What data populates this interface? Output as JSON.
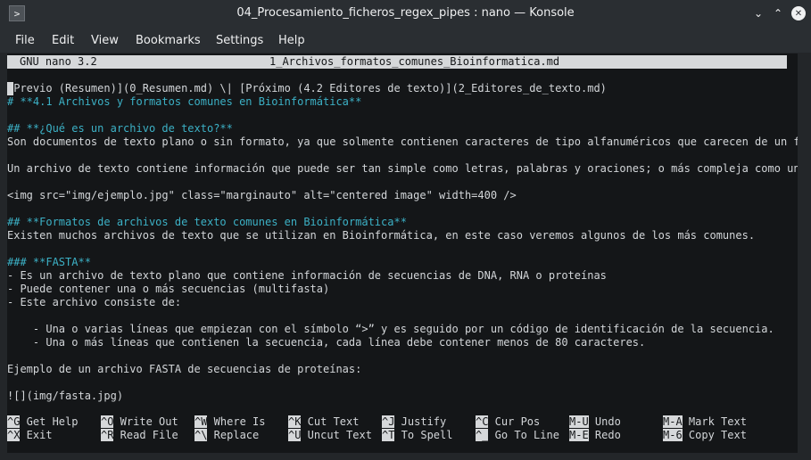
{
  "window": {
    "title": "04_Procesamiento_ficheros_regex_pipes : nano — Konsole",
    "app_icon": ">"
  },
  "menu": [
    "File",
    "Edit",
    "View",
    "Bookmarks",
    "Settings",
    "Help"
  ],
  "nano": {
    "version": "GNU nano 3.2",
    "filename": "1_Archivos_formatos_comunes_Bioinformatica.md",
    "lines": [
      {
        "text": "[Previo (Resumen)](0_Resumen.md) \\| [Próximo (4.2 Editores de texto)](2_Editores_de_texto.md)",
        "style": "normal"
      },
      {
        "text": "# **4.1 Archivos y formatos comunes en Bioinformática**",
        "style": "cyan"
      },
      {
        "text": "",
        "style": "normal"
      },
      {
        "text": "## **¿Qué es un archivo de texto?**",
        "style": "cyan"
      },
      {
        "text": "Son documentos de texto plano o sin formato, ya que solmente contienen caracteres de tipo alfanuméricos que carecen de un fo$",
        "style": "normal"
      },
      {
        "text": "",
        "style": "normal"
      },
      {
        "text": "Un archivo de texto contiene información que puede ser tan simple como letras, palabras y oraciones; o más compleja como un $",
        "style": "normal"
      },
      {
        "text": "",
        "style": "normal"
      },
      {
        "text": "<img src=\"img/ejemplo.jpg\" class=\"marginauto\" alt=\"centered image\" width=400 />",
        "style": "normal"
      },
      {
        "text": "",
        "style": "normal"
      },
      {
        "text": "## **Formatos de archivos de texto comunes en Bioinformática**",
        "style": "cyan"
      },
      {
        "text": "Existen muchos archivos de texto que se utilizan en Bioinformática, en este caso veremos algunos de los más comunes.",
        "style": "normal"
      },
      {
        "text": "",
        "style": "normal"
      },
      {
        "text": "### **FASTA**",
        "style": "cyan"
      },
      {
        "text": "- Es un archivo de texto plano que contiene información de secuencias de DNA, RNA o proteínas",
        "style": "normal"
      },
      {
        "text": "- Puede contener una o más secuencias (multifasta)",
        "style": "normal"
      },
      {
        "text": "- Este archivo consiste de:",
        "style": "normal"
      },
      {
        "text": "",
        "style": "normal"
      },
      {
        "text": "    - Una o varias líneas que empiezan con el símbolo “>” y es seguido por un código de identificación de la secuencia.",
        "style": "normal"
      },
      {
        "text": "    - Una o más líneas que contienen la secuencia, cada línea debe contener menos de 80 caracteres.",
        "style": "normal"
      },
      {
        "text": "",
        "style": "normal"
      },
      {
        "text": "Ejemplo de un archivo FASTA de secuencias de proteínas:",
        "style": "normal"
      },
      {
        "text": "",
        "style": "normal"
      },
      {
        "text": "![](img/fasta.jpg)",
        "style": "normal"
      }
    ],
    "shortcuts": [
      [
        {
          "key": "^G",
          "label": "Get Help"
        },
        {
          "key": "^O",
          "label": "Write Out"
        },
        {
          "key": "^W",
          "label": "Where Is"
        },
        {
          "key": "^K",
          "label": "Cut Text"
        },
        {
          "key": "^J",
          "label": "Justify"
        },
        {
          "key": "^C",
          "label": "Cur Pos"
        },
        {
          "key": "M-U",
          "label": "Undo"
        },
        {
          "key": "M-A",
          "label": "Mark Text"
        }
      ],
      [
        {
          "key": "^X",
          "label": "Exit"
        },
        {
          "key": "^R",
          "label": "Read File"
        },
        {
          "key": "^\\",
          "label": "Replace"
        },
        {
          "key": "^U",
          "label": "Uncut Text"
        },
        {
          "key": "^T",
          "label": "To Spell"
        },
        {
          "key": "^_",
          "label": "Go To Line"
        },
        {
          "key": "M-E",
          "label": "Redo"
        },
        {
          "key": "M-6",
          "label": "Copy Text"
        }
      ]
    ]
  }
}
